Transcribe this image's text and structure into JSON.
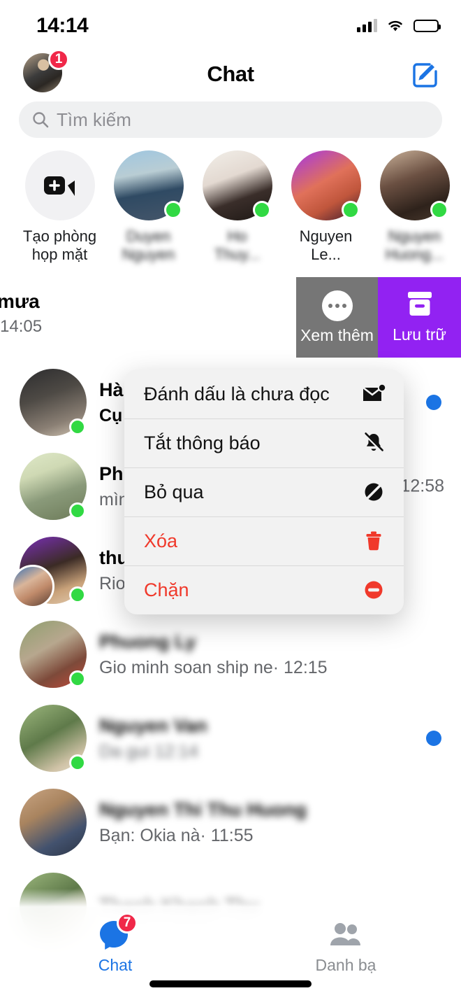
{
  "status_bar": {
    "time": "14:14",
    "signal_icon": "cellular-bars-icon",
    "wifi_icon": "wifi-icon",
    "battery_icon": "battery-icon"
  },
  "header": {
    "title": "Chat",
    "avatar_badge": "1",
    "compose_icon": "compose-icon"
  },
  "search": {
    "placeholder": "Tìm kiếm",
    "icon": "search-icon"
  },
  "active_now": {
    "create_room": {
      "label_line1": "Tạo phòng",
      "label_line2": "họp mặt",
      "icon": "video-plus-icon"
    },
    "people": [
      {
        "name_line1": "Duyen",
        "name_line2": "Nguyen",
        "online": true,
        "blurred": true
      },
      {
        "name_line1": "Ho",
        "name_line2": "Thuy...",
        "online": true,
        "blurred": true
      },
      {
        "name_line1": "Nguyen",
        "name_line2": "Le...",
        "online": true,
        "blurred": false
      },
      {
        "name_line1": "Nguyen",
        "name_line2": "Huong...",
        "online": true,
        "blurred": true
      }
    ]
  },
  "swipe_actions": {
    "more": {
      "label": "Xem thêm",
      "icon": "ellipsis-icon",
      "color": "#767676"
    },
    "archive": {
      "label": "Lưu trữ",
      "icon": "archive-box-icon",
      "color": "#9222f2"
    }
  },
  "swiped_row": {
    "title_fragment": "mưa",
    "time": "14:05"
  },
  "context_menu": {
    "items": [
      {
        "label": "Đánh dấu là chưa đọc",
        "icon": "envelope-unread-icon",
        "danger": false
      },
      {
        "label": "Tắt thông báo",
        "icon": "bell-slash-icon",
        "danger": false
      },
      {
        "label": "Bỏ qua",
        "icon": "circle-slash-icon",
        "danger": false
      },
      {
        "label": "Xóa",
        "icon": "trash-icon",
        "danger": true
      },
      {
        "label": "Chặn",
        "icon": "block-icon",
        "danger": true
      }
    ]
  },
  "chat_list": [
    {
      "name": "Hà",
      "snippet": "Cụ",
      "time": "",
      "online": true,
      "unread": true,
      "unread_dot": true,
      "blur_name": false,
      "blur_snippet": false
    },
    {
      "name": "Ph",
      "snippet": "mìn",
      "time": "12:58",
      "online": true,
      "unread": false,
      "unread_dot": false,
      "blur_name": false,
      "blur_snippet": false
    },
    {
      "name": "thu",
      "snippet": "Rio",
      "time": "",
      "online": true,
      "unread": false,
      "unread_dot": false,
      "blur_name": false,
      "blur_snippet": false
    },
    {
      "name": "Phuong Ly",
      "snippet": "Gio minh soan ship ne· 12:15",
      "time": "",
      "online": true,
      "unread": false,
      "unread_dot": false,
      "blur_name": true,
      "blur_snippet": false
    },
    {
      "name": "Nguyen Van",
      "snippet": "Da gui  12:14",
      "time": "",
      "online": true,
      "unread": true,
      "unread_dot": true,
      "blur_name": true,
      "blur_snippet": true
    },
    {
      "name": "Nguyen Thi Thu Huong",
      "snippet": "Bạn: Okia nà· 11:55",
      "time": "",
      "online": false,
      "unread": false,
      "unread_dot": false,
      "blur_name": true,
      "blur_snippet": false
    },
    {
      "name": "Thanh Khanh Thu",
      "snippet": "",
      "time": "",
      "online": false,
      "unread": false,
      "unread_dot": false,
      "blur_name": true,
      "blur_snippet": false
    }
  ],
  "tab_bar": {
    "chat": {
      "label": "Chat",
      "badge": "7",
      "icon": "chat-bubble-icon"
    },
    "contacts": {
      "label": "Danh bạ",
      "icon": "people-icon"
    }
  },
  "colors": {
    "accent_blue": "#1b74e4",
    "badge_red": "#f02849",
    "online_green": "#31d943",
    "archive_purple": "#9222f2",
    "more_gray": "#767676",
    "danger_red": "#f0392b"
  }
}
